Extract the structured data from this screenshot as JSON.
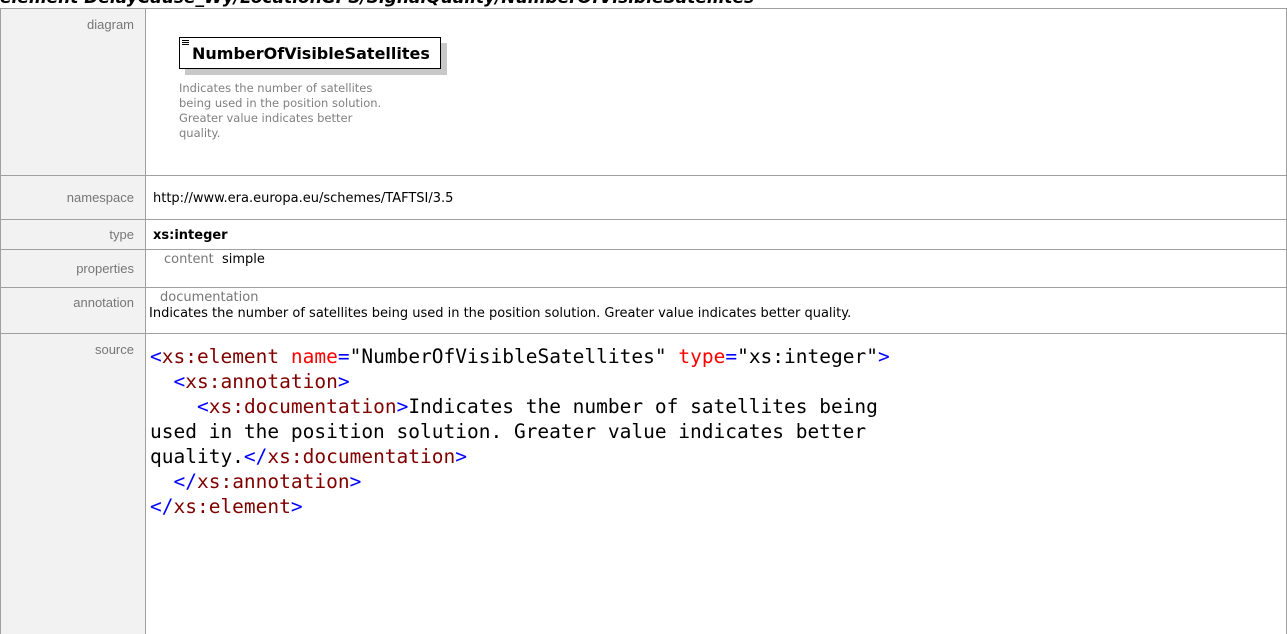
{
  "header": {
    "title": "element DelayCause_Wy/LocationGPS/SignalQuality/NumberOfVisibleSatellites"
  },
  "labels": {
    "diagram": "diagram",
    "namespace": "namespace",
    "type": "type",
    "properties": "properties",
    "annotation": "annotation",
    "source": "source"
  },
  "diagram": {
    "element_name": "NumberOfVisibleSatellites",
    "doc_lines": [
      "Indicates the number of satellites",
      "being used in the position solution.",
      "Greater value indicates better",
      "quality."
    ],
    "doc_icon": "documentation-icon"
  },
  "namespace": {
    "value": "http://www.era.europa.eu/schemes/TAFTSI/3.5"
  },
  "type": {
    "value": "xs:integer"
  },
  "properties": {
    "key": "content",
    "value": "simple"
  },
  "annotation": {
    "key": "documentation",
    "text": "Indicates the number of satellites being used in the position solution. Greater value indicates better quality."
  },
  "source": {
    "element_open": "xs:element",
    "attr_name": "name",
    "attr_name_value": "\"NumberOfVisibleSatellites\"",
    "attr_type": "type",
    "attr_type_value": "\"xs:integer\"",
    "annotation_tag": "xs:annotation",
    "documentation_tag": "xs:documentation",
    "documentation_text": "Indicates the number of satellites being used in the position solution. Greater value indicates better quality.",
    "colors": {
      "bracket": "#0000ff",
      "tag_name": "#800000",
      "attr_name": "#ff0000",
      "attr_value": "#000000"
    }
  }
}
